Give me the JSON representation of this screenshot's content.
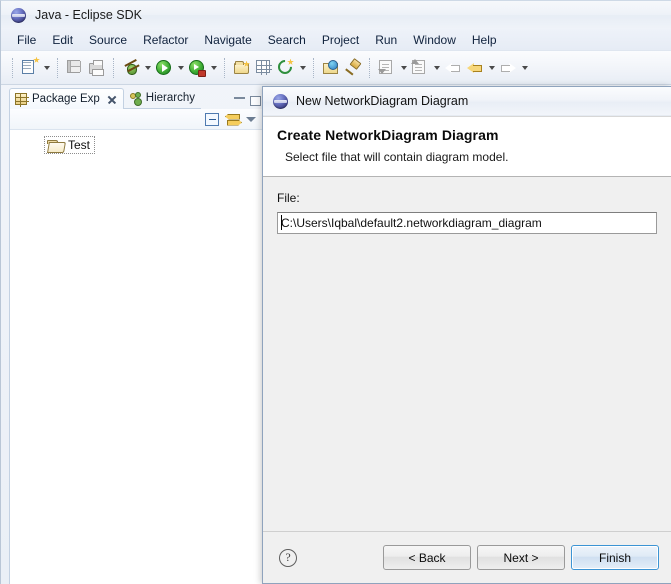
{
  "window": {
    "title": "Java - Eclipse SDK",
    "app_icon": "eclipse-sphere-icon"
  },
  "menubar": {
    "items": [
      {
        "label": "File"
      },
      {
        "label": "Edit"
      },
      {
        "label": "Source"
      },
      {
        "label": "Refactor"
      },
      {
        "label": "Navigate"
      },
      {
        "label": "Search"
      },
      {
        "label": "Project"
      },
      {
        "label": "Run"
      },
      {
        "label": "Window"
      },
      {
        "label": "Help"
      }
    ]
  },
  "toolbar": {
    "icons": [
      "new-wizard-icon",
      "new-wizard-dropdown",
      "save-icon",
      "print-icon",
      "debug-icon",
      "debug-dropdown",
      "run-icon",
      "run-dropdown",
      "run-configurations-icon",
      "run-configurations-dropdown",
      "new-java-package-icon",
      "new-java-class-icon",
      "new-java-interface-icon",
      "new-java-dropdown",
      "open-type-icon",
      "open-task-icon",
      "next-annotation-icon",
      "next-annotation-dropdown",
      "previous-annotation-icon",
      "previous-annotation-dropdown",
      "back-icon",
      "forward-icon",
      "forward-dropdown",
      "last-edit-location-icon",
      "last-edit-dropdown"
    ]
  },
  "explorer": {
    "tabs": [
      {
        "label": "Package Exp",
        "icon": "package-explorer-icon",
        "active": true,
        "closable": true
      },
      {
        "label": "Hierarchy",
        "icon": "hierarchy-icon",
        "active": false,
        "closable": false
      }
    ],
    "window_buttons": [
      "minimize-view-button",
      "maximize-view-button"
    ],
    "view_toolbar": [
      "collapse-all-icon",
      "link-with-editor-icon",
      "view-menu-icon"
    ],
    "tree": [
      {
        "label": "Test",
        "icon": "open-folder-icon",
        "focused": true
      }
    ]
  },
  "dialog": {
    "title": "New NetworkDiagram Diagram",
    "title_icon": "eclipse-sphere-icon",
    "heading": "Create NetworkDiagram Diagram",
    "subheading": "Select file that will contain diagram model.",
    "file_label": "File:",
    "file_value": "C:\\Users\\Iqbal\\default2.networkdiagram_diagram",
    "file_placeholder": "",
    "help_label": "?",
    "buttons": [
      {
        "label": "< Back",
        "default": false
      },
      {
        "label": "Next >",
        "default": false
      },
      {
        "label": "Finish",
        "default": true
      }
    ],
    "accent_color": "#3c94d4"
  }
}
